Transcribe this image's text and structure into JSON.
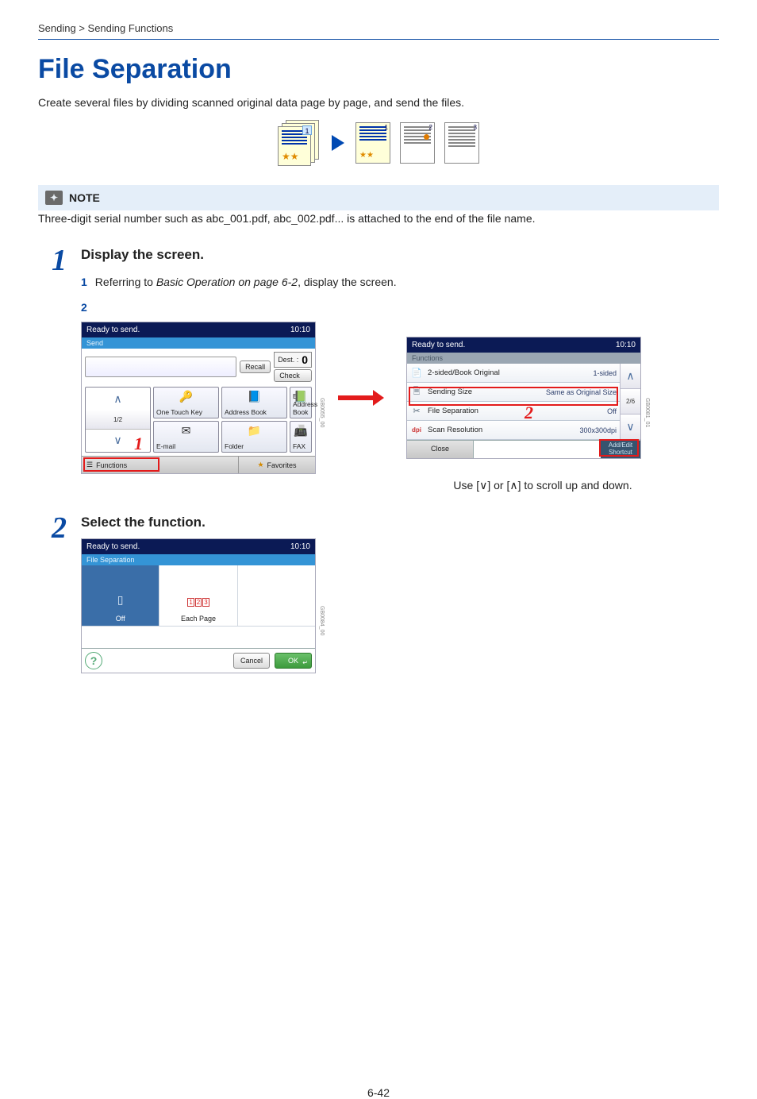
{
  "breadcrumb": "Sending > Sending Functions",
  "title": "File Separation",
  "intro": "Create several files by dividing scanned original data page by page, and send the files.",
  "diagram": {
    "p1": "1",
    "p2": "1",
    "p3": "2",
    "p4": "3"
  },
  "note": {
    "label": "NOTE",
    "text": "Three-digit serial number such as abc_001.pdf, abc_002.pdf... is attached to the end of the file name."
  },
  "step1": {
    "num": "1",
    "heading": "Display the screen.",
    "sub1_num": "1",
    "sub1_a": "Referring to ",
    "sub1_link": "Basic Operation on page 6-2",
    "sub1_b": ", display the screen.",
    "sub2_num": "2",
    "red1": "1",
    "red2": "2"
  },
  "screenA": {
    "status": "Ready to send.",
    "time": "10:10",
    "mode": "Send",
    "dest_label": "Dest. :",
    "dest_count": "0",
    "check": "Check",
    "recall": "Recall",
    "tabs": {
      "one_touch": "One Touch Key",
      "address_book": "Address Book",
      "ext_ab": "Ext Address Book",
      "email": "E-mail",
      "folder": "Folder",
      "fax": "FAX"
    },
    "page": "1/2",
    "functions": "Functions",
    "favorites": "Favorites",
    "code": "GB0055_00"
  },
  "screenB": {
    "status": "Ready to send.",
    "time": "10:10",
    "mode": "Functions",
    "rows": [
      {
        "icon": "📄",
        "label": "2-sided/Book Original",
        "value": "1-sided"
      },
      {
        "icon": "🗎",
        "label": "Sending Size",
        "value": "Same as Original Size"
      },
      {
        "icon": "✂",
        "label": "File Separation",
        "value": "Off"
      },
      {
        "icon": "dpi",
        "label": "Scan Resolution",
        "value": "300x300dpi"
      }
    ],
    "page": "2/6",
    "close": "Close",
    "addedit": "Add/Edit Shortcut",
    "code": "GB0081_01"
  },
  "scroll_hint_a": "Use [",
  "scroll_hint_b": "] or [",
  "scroll_hint_c": "] to scroll up and down.",
  "step2": {
    "num": "2",
    "heading": "Select the function."
  },
  "screenC": {
    "status": "Ready to send.",
    "time": "10:10",
    "mode": "File Separation",
    "off": "Off",
    "each": "Each Page",
    "cancel": "Cancel",
    "ok": "OK",
    "code": "GB0084_00"
  },
  "page_num": "6-42"
}
